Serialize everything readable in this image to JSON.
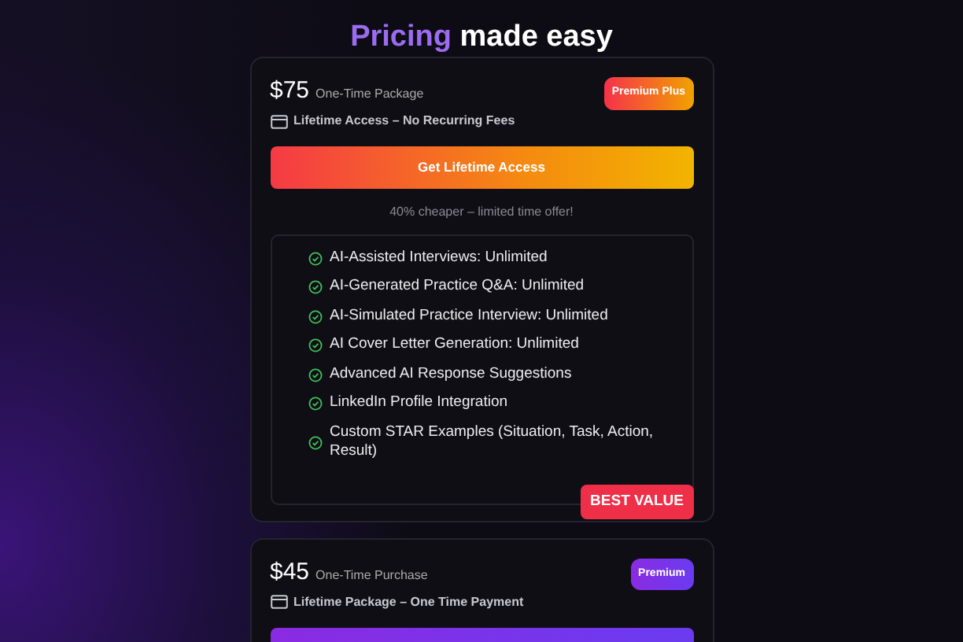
{
  "title": {
    "highlight": "Pricing",
    "rest": "made easy"
  },
  "plans": [
    {
      "kind": "plus",
      "price": "$75",
      "price_note": "One-Time Package",
      "badge": "Premium Plus",
      "subtitle": "Lifetime Access – No Recurring Fees",
      "cta": "Get Lifetime Access",
      "offer": "40% cheaper – limited time offer!",
      "features": [
        "AI-Assisted Interviews: Unlimited",
        "AI-Generated Practice Q&A: Unlimited",
        "AI-Simulated Practice Interview: Unlimited",
        "AI Cover Letter Generation: Unlimited",
        "Advanced AI Response Suggestions",
        "LinkedIn Profile Integration",
        "Custom STAR Examples (Situation, Task, Action, Result)"
      ],
      "ribbon": "BEST VALUE"
    },
    {
      "kind": "premium",
      "price": "$45",
      "price_note": "One-Time Purchase",
      "badge": "Premium",
      "subtitle": "Lifetime Package – One Time Payment"
    }
  ]
}
